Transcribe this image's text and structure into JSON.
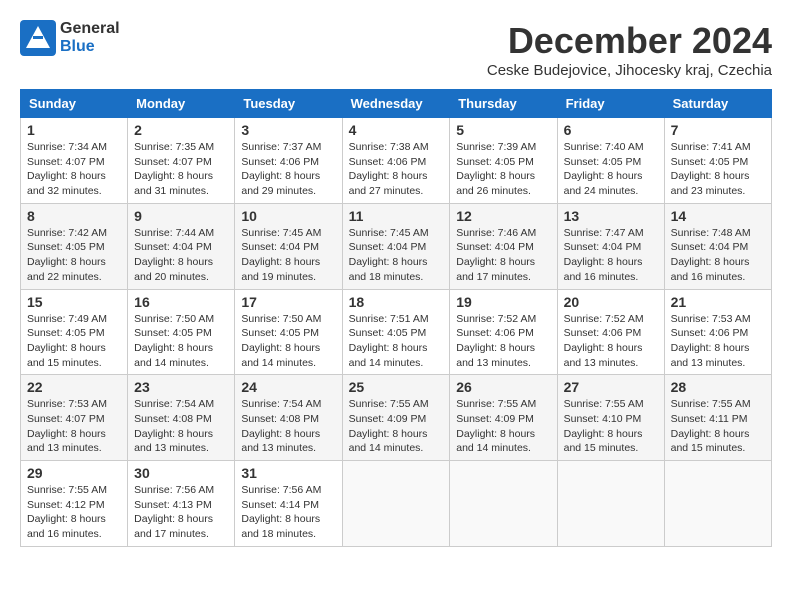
{
  "logo": {
    "general": "General",
    "blue": "Blue"
  },
  "title": "December 2024",
  "location": "Ceske Budejovice, Jihocesky kraj, Czechia",
  "weekdays": [
    "Sunday",
    "Monday",
    "Tuesday",
    "Wednesday",
    "Thursday",
    "Friday",
    "Saturday"
  ],
  "weeks": [
    [
      {
        "day": "1",
        "sunrise": "7:34 AM",
        "sunset": "4:07 PM",
        "daylight": "8 hours and 32 minutes."
      },
      {
        "day": "2",
        "sunrise": "7:35 AM",
        "sunset": "4:07 PM",
        "daylight": "8 hours and 31 minutes."
      },
      {
        "day": "3",
        "sunrise": "7:37 AM",
        "sunset": "4:06 PM",
        "daylight": "8 hours and 29 minutes."
      },
      {
        "day": "4",
        "sunrise": "7:38 AM",
        "sunset": "4:06 PM",
        "daylight": "8 hours and 27 minutes."
      },
      {
        "day": "5",
        "sunrise": "7:39 AM",
        "sunset": "4:05 PM",
        "daylight": "8 hours and 26 minutes."
      },
      {
        "day": "6",
        "sunrise": "7:40 AM",
        "sunset": "4:05 PM",
        "daylight": "8 hours and 24 minutes."
      },
      {
        "day": "7",
        "sunrise": "7:41 AM",
        "sunset": "4:05 PM",
        "daylight": "8 hours and 23 minutes."
      }
    ],
    [
      {
        "day": "8",
        "sunrise": "7:42 AM",
        "sunset": "4:05 PM",
        "daylight": "8 hours and 22 minutes."
      },
      {
        "day": "9",
        "sunrise": "7:44 AM",
        "sunset": "4:04 PM",
        "daylight": "8 hours and 20 minutes."
      },
      {
        "day": "10",
        "sunrise": "7:45 AM",
        "sunset": "4:04 PM",
        "daylight": "8 hours and 19 minutes."
      },
      {
        "day": "11",
        "sunrise": "7:45 AM",
        "sunset": "4:04 PM",
        "daylight": "8 hours and 18 minutes."
      },
      {
        "day": "12",
        "sunrise": "7:46 AM",
        "sunset": "4:04 PM",
        "daylight": "8 hours and 17 minutes."
      },
      {
        "day": "13",
        "sunrise": "7:47 AM",
        "sunset": "4:04 PM",
        "daylight": "8 hours and 16 minutes."
      },
      {
        "day": "14",
        "sunrise": "7:48 AM",
        "sunset": "4:04 PM",
        "daylight": "8 hours and 16 minutes."
      }
    ],
    [
      {
        "day": "15",
        "sunrise": "7:49 AM",
        "sunset": "4:05 PM",
        "daylight": "8 hours and 15 minutes."
      },
      {
        "day": "16",
        "sunrise": "7:50 AM",
        "sunset": "4:05 PM",
        "daylight": "8 hours and 14 minutes."
      },
      {
        "day": "17",
        "sunrise": "7:50 AM",
        "sunset": "4:05 PM",
        "daylight": "8 hours and 14 minutes."
      },
      {
        "day": "18",
        "sunrise": "7:51 AM",
        "sunset": "4:05 PM",
        "daylight": "8 hours and 14 minutes."
      },
      {
        "day": "19",
        "sunrise": "7:52 AM",
        "sunset": "4:06 PM",
        "daylight": "8 hours and 13 minutes."
      },
      {
        "day": "20",
        "sunrise": "7:52 AM",
        "sunset": "4:06 PM",
        "daylight": "8 hours and 13 minutes."
      },
      {
        "day": "21",
        "sunrise": "7:53 AM",
        "sunset": "4:06 PM",
        "daylight": "8 hours and 13 minutes."
      }
    ],
    [
      {
        "day": "22",
        "sunrise": "7:53 AM",
        "sunset": "4:07 PM",
        "daylight": "8 hours and 13 minutes."
      },
      {
        "day": "23",
        "sunrise": "7:54 AM",
        "sunset": "4:08 PM",
        "daylight": "8 hours and 13 minutes."
      },
      {
        "day": "24",
        "sunrise": "7:54 AM",
        "sunset": "4:08 PM",
        "daylight": "8 hours and 13 minutes."
      },
      {
        "day": "25",
        "sunrise": "7:55 AM",
        "sunset": "4:09 PM",
        "daylight": "8 hours and 14 minutes."
      },
      {
        "day": "26",
        "sunrise": "7:55 AM",
        "sunset": "4:09 PM",
        "daylight": "8 hours and 14 minutes."
      },
      {
        "day": "27",
        "sunrise": "7:55 AM",
        "sunset": "4:10 PM",
        "daylight": "8 hours and 15 minutes."
      },
      {
        "day": "28",
        "sunrise": "7:55 AM",
        "sunset": "4:11 PM",
        "daylight": "8 hours and 15 minutes."
      }
    ],
    [
      {
        "day": "29",
        "sunrise": "7:55 AM",
        "sunset": "4:12 PM",
        "daylight": "8 hours and 16 minutes."
      },
      {
        "day": "30",
        "sunrise": "7:56 AM",
        "sunset": "4:13 PM",
        "daylight": "8 hours and 17 minutes."
      },
      {
        "day": "31",
        "sunrise": "7:56 AM",
        "sunset": "4:14 PM",
        "daylight": "8 hours and 18 minutes."
      },
      null,
      null,
      null,
      null
    ]
  ]
}
